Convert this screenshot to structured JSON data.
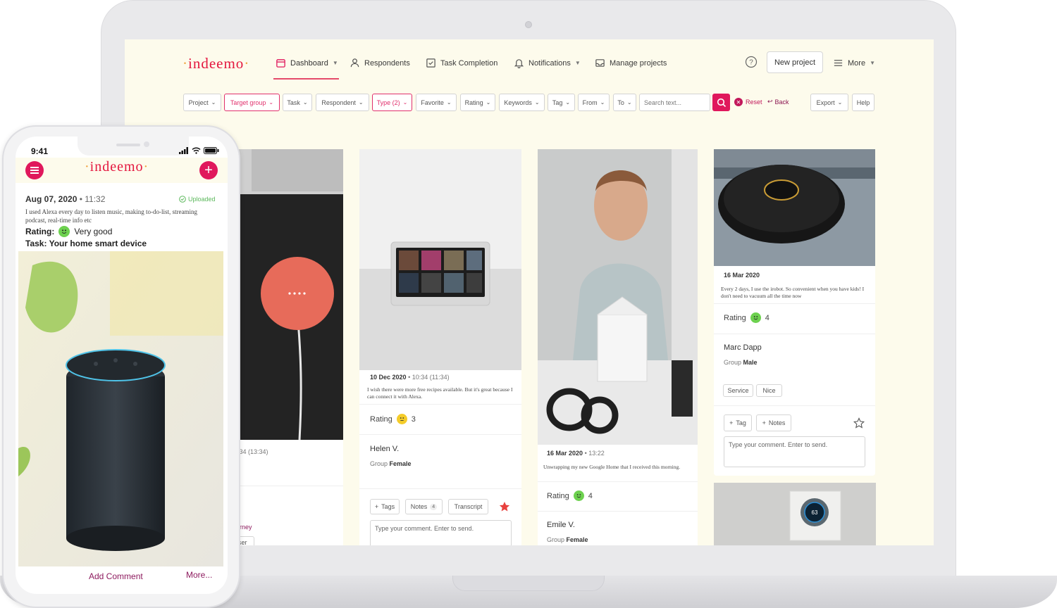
{
  "colors": {
    "brand": "#e0185c",
    "accent_purple": "#8d1a5e",
    "screen_bg": "#fdfbec"
  },
  "nav": {
    "logo": "indeemo",
    "items": [
      {
        "label": "Dashboard",
        "icon": "calendar-icon"
      },
      {
        "label": "Respondents",
        "icon": "person-icon"
      },
      {
        "label": "Task Completion",
        "icon": "checkbox-icon"
      },
      {
        "label": "Notifications",
        "icon": "bell-icon"
      },
      {
        "label": "Manage projects",
        "icon": "inbox-icon"
      }
    ],
    "new_project": "New project",
    "more": "More"
  },
  "filters": {
    "project": "Project",
    "target_group": "Target group",
    "task": "Task",
    "respondent": "Respondent",
    "type": "Type (2)",
    "favorite": "Favorite",
    "rating": "Rating",
    "keywords": "Keywords",
    "tag": "Tag",
    "from": "From",
    "to": "To",
    "search_placeholder": "Search text...",
    "reset": "Reset",
    "back": "Back",
    "export": "Export",
    "help": "Help"
  },
  "cards": {
    "c1": {
      "date_tail": ":34 (13:34)",
      "task_fragment": "urney",
      "tag_fragment": "User"
    },
    "c2": {
      "date": "10 Dec 2020",
      "time": "10:34 (11:34)",
      "desc": "I wish there were more free recipes available. But it's great because I can connect it with Alexa.",
      "rating_label": "Rating",
      "rating_value": "3",
      "person": "Helen V.",
      "group_label": "Group",
      "group_value": "Female",
      "tags": "Tags",
      "notes": "Notes",
      "notes_count": "4",
      "transcript": "Transcript",
      "comment_placeholder": "Type your comment. Enter to send."
    },
    "c3": {
      "date": "16 Mar 2020",
      "time": "13:22",
      "desc": "Unwrapping my new Google Home that I received this morning.",
      "rating_label": "Rating",
      "rating_value": "4",
      "person": "Emile V.",
      "group_label": "Group",
      "group_value": "Female"
    },
    "c4": {
      "date": "16 Mar 2020",
      "desc": "Every 2 days, I use the irobot. So convenient when you have kids! I don't need to vacuum all the time now",
      "rating_label": "Rating",
      "rating_value": "4",
      "person": "Marc Dapp",
      "group_label": "Group",
      "group_value": "Male",
      "tag1": "Service",
      "tag2": "Nice",
      "tag_btn": "Tag",
      "notes_btn": "Notes",
      "comment_placeholder": "Type your comment. Enter to send."
    }
  },
  "phone": {
    "time": "9:41",
    "logo": "indeemo",
    "date": "Aug 07, 2020",
    "clock": "11:32",
    "uploaded": "Uploaded",
    "desc": "I used Alexa every day to listen music, making to-do-list, streaming podcast, real-time info etc",
    "rating_label": "Rating:",
    "rating_value": "Very good",
    "task": "Task: Your home smart device",
    "add_comment": "Add Comment",
    "more": "More..."
  }
}
